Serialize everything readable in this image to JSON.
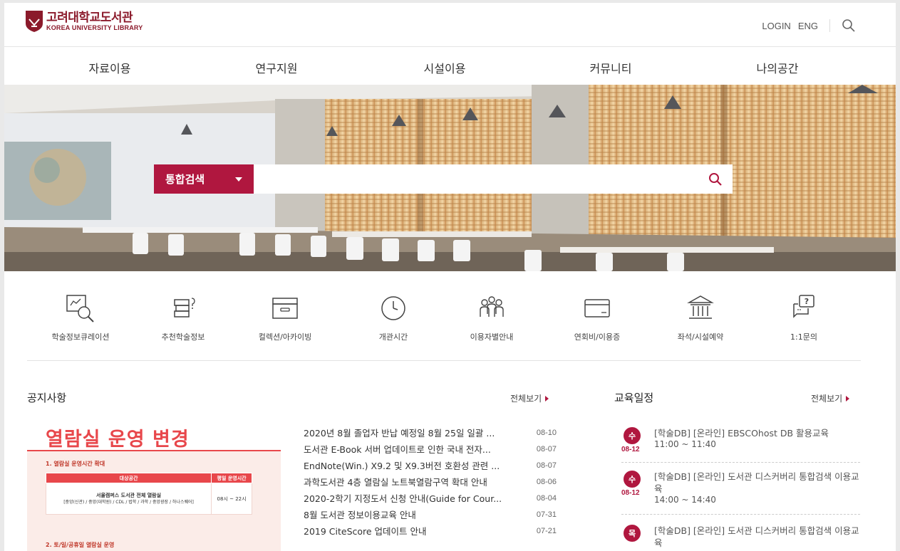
{
  "header": {
    "logo_ko": "고려대학교도서관",
    "logo_en": "KOREA UNIVERSITY LIBRARY",
    "login": "LOGIN",
    "lang": "ENG",
    "search_icon": "search-icon"
  },
  "nav": [
    "자료이용",
    "연구지원",
    "시설이용",
    "커뮤니티",
    "나의공간"
  ],
  "search": {
    "scope": "통합검색",
    "value": "",
    "icon": "search-icon",
    "accent": "#b0173f"
  },
  "quick_menu": [
    {
      "label": "학술정보큐레이션",
      "icon": "curation-icon"
    },
    {
      "label": "추천학술정보",
      "icon": "books-icon"
    },
    {
      "label": "컬렉션/아카이빙",
      "icon": "archive-box-icon"
    },
    {
      "label": "개관시간",
      "icon": "clock-icon"
    },
    {
      "label": "이용자별안내",
      "icon": "users-icon"
    },
    {
      "label": "연회비/이용증",
      "icon": "card-icon"
    },
    {
      "label": "좌석/시설예약",
      "icon": "building-icon"
    },
    {
      "label": "1:1문의",
      "icon": "question-bubble-icon"
    }
  ],
  "notices": {
    "title": "공지사항",
    "more": "전체보기",
    "banner": {
      "title": "열람실 운영 변경",
      "section1": "1. 열람실 운영시간 확대",
      "col1": "대상공간",
      "col2": "평일 운영시간",
      "place": "서울캠퍼스 도서관 전체 열람실",
      "place_detail": "[중앙(신관) / 중앙(대학원) / CDL / 법학 / 과학 / 중앙광장 / 하나스퀘어]",
      "hours": "08시 ~ 22시",
      "section2": "2. 토/일/공휴일 열람실 운영"
    },
    "items": [
      {
        "title": "2020년 8월 졸업자 반납 예정일 8월 25일 일괄 ...",
        "date": "08-10"
      },
      {
        "title": "도서관 E-Book 서버 업데이트로 인한 국내 전자...",
        "date": "08-07"
      },
      {
        "title": "EndNote(Win.) X9.2 및 X9.3버전 호환성 관련 ...",
        "date": "08-07"
      },
      {
        "title": "과학도서관 4층 열람실 노트북열람구역 확대 안내",
        "date": "08-06"
      },
      {
        "title": "2020-2학기 지정도서 신청 안내(Guide for Cour...",
        "date": "08-04"
      },
      {
        "title": "8월 도서관 정보이용교육 안내",
        "date": "07-31"
      },
      {
        "title": "2019 CiteScore 업데이트 안내",
        "date": "07-21"
      }
    ]
  },
  "education": {
    "title": "교육일정",
    "more": "전체보기",
    "items": [
      {
        "day": "수",
        "date": "08-12",
        "title": "[학술DB] [온라인] EBSCOhost DB 활용교육",
        "time": "11:00 ~ 11:40"
      },
      {
        "day": "수",
        "date": "08-12",
        "title": "[학술DB] [온라인] 도서관 디스커버리 통합검색 이용교육",
        "time": "14:00 ~ 14:40"
      },
      {
        "day": "목",
        "date": "",
        "title": "[학술DB] [온라인] 도서관 디스커버리 통합검색 이용교육",
        "time": ""
      }
    ]
  }
}
